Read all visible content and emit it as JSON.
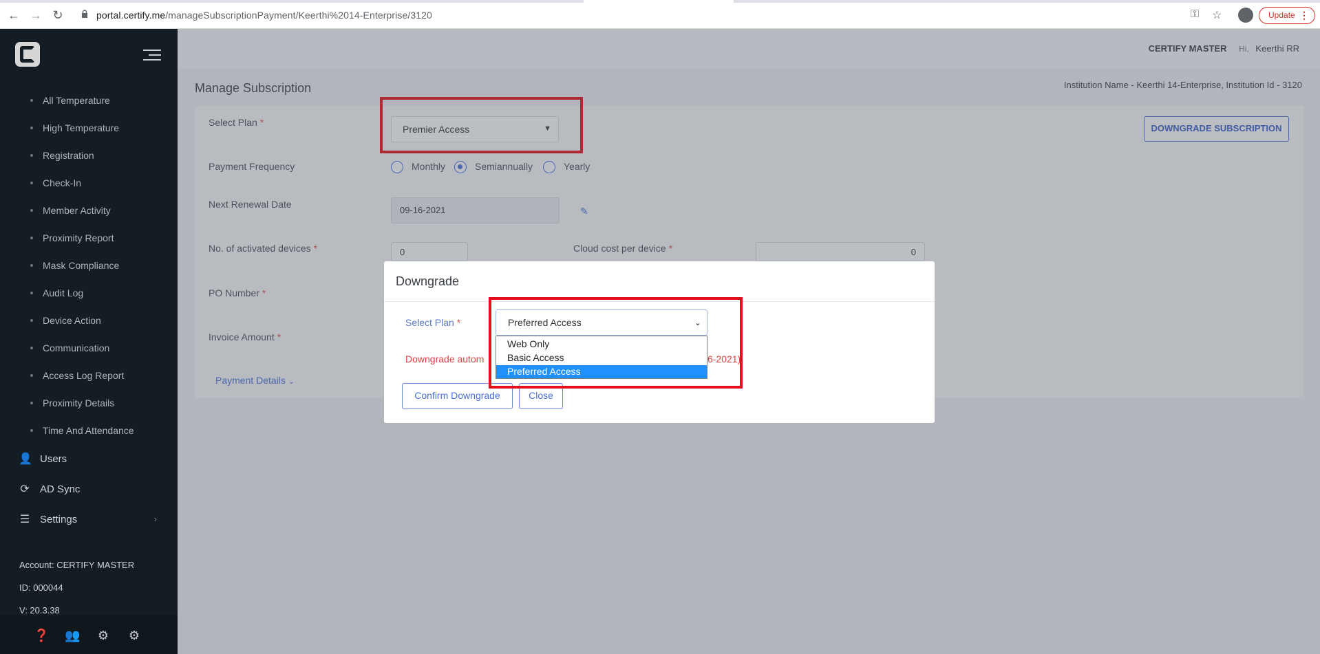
{
  "browser": {
    "url_host": "portal.certify.me",
    "url_path": "/manageSubscriptionPayment/Keerthi%2014-Enterprise/3120",
    "update_label": "Update"
  },
  "sidebar": {
    "sub_items": [
      {
        "label": "All Temperature"
      },
      {
        "label": "High Temperature"
      },
      {
        "label": "Registration"
      },
      {
        "label": "Check-In"
      },
      {
        "label": "Member Activity"
      },
      {
        "label": "Proximity Report"
      },
      {
        "label": "Mask Compliance"
      },
      {
        "label": "Audit Log"
      },
      {
        "label": "Device Action"
      },
      {
        "label": "Communication"
      },
      {
        "label": "Access Log Report"
      },
      {
        "label": "Proximity Details"
      },
      {
        "label": "Time And Attendance"
      }
    ],
    "main_items": [
      {
        "label": "Users",
        "icon": "user-icon"
      },
      {
        "label": "AD Sync",
        "icon": "sync-icon"
      },
      {
        "label": "Settings",
        "icon": "sliders-icon"
      }
    ],
    "account": "Account: CERTIFY MASTER",
    "id": "ID: 000044",
    "version": "V: 20.3.38",
    "footer_icons": [
      "help-icon",
      "user-settings-icon",
      "gears-icon",
      "gear-icon"
    ]
  },
  "header": {
    "master": "CERTIFY MASTER",
    "greeting": "Hi,",
    "user": "Keerthi RR"
  },
  "page": {
    "title": "Manage Subscription",
    "institution": "Institution Name - Keerthi 14-Enterprise,  Institution Id - 3120",
    "select_plan_label": "Select Plan",
    "select_plan_value": "Premier Access",
    "downgrade_button": "DOWNGRADE SUBSCRIPTION",
    "payment_frequency_label": "Payment Frequency",
    "frequency_options": [
      "Monthly",
      "Semiannually",
      "Yearly"
    ],
    "frequency_selected": "Semiannually",
    "renewal_label": "Next Renewal Date",
    "renewal_value": "09-16-2021",
    "devices_label": "No. of activated devices",
    "devices_value": "0",
    "cloud_cost_label": "Cloud cost per device",
    "cloud_cost_value": "0",
    "po_label": "PO Number",
    "invoice_label": "Invoice Amount",
    "payment_details": "Payment Details"
  },
  "modal": {
    "title": "Downgrade",
    "select_plan_label": "Select Plan",
    "selected_value": "Preferred Access",
    "options": [
      "Web Only",
      "Basic Access",
      "Preferred Access"
    ],
    "warning_start": "Downgrade autom",
    "warning_end": "6-2021)",
    "confirm_button": "Confirm Downgrade",
    "close_button": "Close"
  },
  "colors": {
    "accent": "#4a6fd8",
    "highlight_box": "#e0111d",
    "sidebar_bg": "#141c24",
    "dropdown_selected": "#1e90ff"
  }
}
